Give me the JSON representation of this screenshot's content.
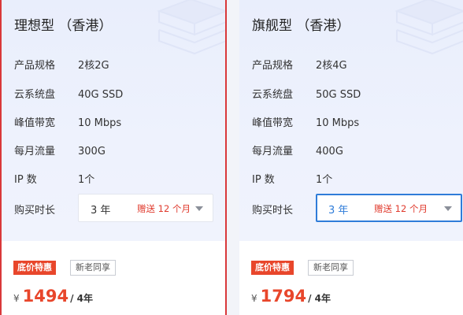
{
  "colors": {
    "accent_red": "#e8462b",
    "selected_border_red": "#d9383a",
    "focus_blue": "#2f7cd9"
  },
  "cards": [
    {
      "title": "理想型 （香港）",
      "specs": [
        {
          "label": "产品规格",
          "value": "2核2G"
        },
        {
          "label": "云系统盘",
          "value": "40G SSD"
        },
        {
          "label": "峰值带宽",
          "value": "10 Mbps"
        },
        {
          "label": "每月流量",
          "value": "300G"
        },
        {
          "label": "IP 数",
          "value": "1个"
        }
      ],
      "duration_label": "购买时长",
      "duration": {
        "selected": "3 年",
        "gift": "赠送 12 个月"
      },
      "badges": {
        "hot": "底价特惠",
        "new": "新老同享"
      },
      "price": {
        "currency": "¥",
        "amount": "1494",
        "per": "/ 4年"
      }
    },
    {
      "title": "旗舰型 （香港）",
      "specs": [
        {
          "label": "产品规格",
          "value": "2核4G"
        },
        {
          "label": "云系统盘",
          "value": "50G SSD"
        },
        {
          "label": "峰值带宽",
          "value": "10 Mbps"
        },
        {
          "label": "每月流量",
          "value": "400G"
        },
        {
          "label": "IP 数",
          "value": "1个"
        }
      ],
      "duration_label": "购买时长",
      "duration": {
        "selected": "3 年",
        "gift": "赠送 12 个月"
      },
      "badges": {
        "hot": "底价特惠",
        "new": "新老同享"
      },
      "price": {
        "currency": "¥",
        "amount": "1794",
        "per": "/ 4年"
      }
    }
  ]
}
